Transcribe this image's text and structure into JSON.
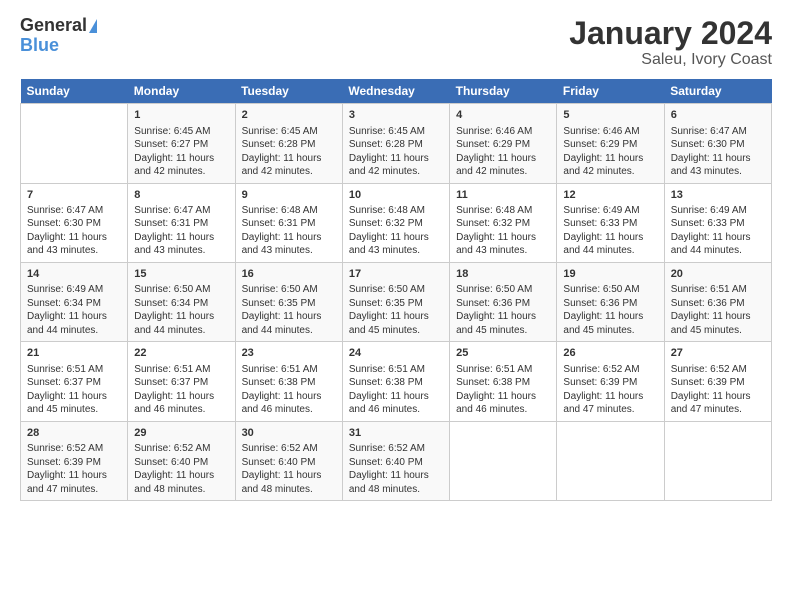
{
  "logo": {
    "line1": "General",
    "line2": "Blue"
  },
  "title": "January 2024",
  "subtitle": "Saleu, Ivory Coast",
  "days_header": [
    "Sunday",
    "Monday",
    "Tuesday",
    "Wednesday",
    "Thursday",
    "Friday",
    "Saturday"
  ],
  "weeks": [
    [
      {
        "day": "",
        "sunrise": "",
        "sunset": "",
        "daylight": ""
      },
      {
        "day": "1",
        "sunrise": "Sunrise: 6:45 AM",
        "sunset": "Sunset: 6:27 PM",
        "daylight": "Daylight: 11 hours and 42 minutes."
      },
      {
        "day": "2",
        "sunrise": "Sunrise: 6:45 AM",
        "sunset": "Sunset: 6:28 PM",
        "daylight": "Daylight: 11 hours and 42 minutes."
      },
      {
        "day": "3",
        "sunrise": "Sunrise: 6:45 AM",
        "sunset": "Sunset: 6:28 PM",
        "daylight": "Daylight: 11 hours and 42 minutes."
      },
      {
        "day": "4",
        "sunrise": "Sunrise: 6:46 AM",
        "sunset": "Sunset: 6:29 PM",
        "daylight": "Daylight: 11 hours and 42 minutes."
      },
      {
        "day": "5",
        "sunrise": "Sunrise: 6:46 AM",
        "sunset": "Sunset: 6:29 PM",
        "daylight": "Daylight: 11 hours and 42 minutes."
      },
      {
        "day": "6",
        "sunrise": "Sunrise: 6:47 AM",
        "sunset": "Sunset: 6:30 PM",
        "daylight": "Daylight: 11 hours and 43 minutes."
      }
    ],
    [
      {
        "day": "7",
        "sunrise": "Sunrise: 6:47 AM",
        "sunset": "Sunset: 6:30 PM",
        "daylight": "Daylight: 11 hours and 43 minutes."
      },
      {
        "day": "8",
        "sunrise": "Sunrise: 6:47 AM",
        "sunset": "Sunset: 6:31 PM",
        "daylight": "Daylight: 11 hours and 43 minutes."
      },
      {
        "day": "9",
        "sunrise": "Sunrise: 6:48 AM",
        "sunset": "Sunset: 6:31 PM",
        "daylight": "Daylight: 11 hours and 43 minutes."
      },
      {
        "day": "10",
        "sunrise": "Sunrise: 6:48 AM",
        "sunset": "Sunset: 6:32 PM",
        "daylight": "Daylight: 11 hours and 43 minutes."
      },
      {
        "day": "11",
        "sunrise": "Sunrise: 6:48 AM",
        "sunset": "Sunset: 6:32 PM",
        "daylight": "Daylight: 11 hours and 43 minutes."
      },
      {
        "day": "12",
        "sunrise": "Sunrise: 6:49 AM",
        "sunset": "Sunset: 6:33 PM",
        "daylight": "Daylight: 11 hours and 44 minutes."
      },
      {
        "day": "13",
        "sunrise": "Sunrise: 6:49 AM",
        "sunset": "Sunset: 6:33 PM",
        "daylight": "Daylight: 11 hours and 44 minutes."
      }
    ],
    [
      {
        "day": "14",
        "sunrise": "Sunrise: 6:49 AM",
        "sunset": "Sunset: 6:34 PM",
        "daylight": "Daylight: 11 hours and 44 minutes."
      },
      {
        "day": "15",
        "sunrise": "Sunrise: 6:50 AM",
        "sunset": "Sunset: 6:34 PM",
        "daylight": "Daylight: 11 hours and 44 minutes."
      },
      {
        "day": "16",
        "sunrise": "Sunrise: 6:50 AM",
        "sunset": "Sunset: 6:35 PM",
        "daylight": "Daylight: 11 hours and 44 minutes."
      },
      {
        "day": "17",
        "sunrise": "Sunrise: 6:50 AM",
        "sunset": "Sunset: 6:35 PM",
        "daylight": "Daylight: 11 hours and 45 minutes."
      },
      {
        "day": "18",
        "sunrise": "Sunrise: 6:50 AM",
        "sunset": "Sunset: 6:36 PM",
        "daylight": "Daylight: 11 hours and 45 minutes."
      },
      {
        "day": "19",
        "sunrise": "Sunrise: 6:50 AM",
        "sunset": "Sunset: 6:36 PM",
        "daylight": "Daylight: 11 hours and 45 minutes."
      },
      {
        "day": "20",
        "sunrise": "Sunrise: 6:51 AM",
        "sunset": "Sunset: 6:36 PM",
        "daylight": "Daylight: 11 hours and 45 minutes."
      }
    ],
    [
      {
        "day": "21",
        "sunrise": "Sunrise: 6:51 AM",
        "sunset": "Sunset: 6:37 PM",
        "daylight": "Daylight: 11 hours and 45 minutes."
      },
      {
        "day": "22",
        "sunrise": "Sunrise: 6:51 AM",
        "sunset": "Sunset: 6:37 PM",
        "daylight": "Daylight: 11 hours and 46 minutes."
      },
      {
        "day": "23",
        "sunrise": "Sunrise: 6:51 AM",
        "sunset": "Sunset: 6:38 PM",
        "daylight": "Daylight: 11 hours and 46 minutes."
      },
      {
        "day": "24",
        "sunrise": "Sunrise: 6:51 AM",
        "sunset": "Sunset: 6:38 PM",
        "daylight": "Daylight: 11 hours and 46 minutes."
      },
      {
        "day": "25",
        "sunrise": "Sunrise: 6:51 AM",
        "sunset": "Sunset: 6:38 PM",
        "daylight": "Daylight: 11 hours and 46 minutes."
      },
      {
        "day": "26",
        "sunrise": "Sunrise: 6:52 AM",
        "sunset": "Sunset: 6:39 PM",
        "daylight": "Daylight: 11 hours and 47 minutes."
      },
      {
        "day": "27",
        "sunrise": "Sunrise: 6:52 AM",
        "sunset": "Sunset: 6:39 PM",
        "daylight": "Daylight: 11 hours and 47 minutes."
      }
    ],
    [
      {
        "day": "28",
        "sunrise": "Sunrise: 6:52 AM",
        "sunset": "Sunset: 6:39 PM",
        "daylight": "Daylight: 11 hours and 47 minutes."
      },
      {
        "day": "29",
        "sunrise": "Sunrise: 6:52 AM",
        "sunset": "Sunset: 6:40 PM",
        "daylight": "Daylight: 11 hours and 48 minutes."
      },
      {
        "day": "30",
        "sunrise": "Sunrise: 6:52 AM",
        "sunset": "Sunset: 6:40 PM",
        "daylight": "Daylight: 11 hours and 48 minutes."
      },
      {
        "day": "31",
        "sunrise": "Sunrise: 6:52 AM",
        "sunset": "Sunset: 6:40 PM",
        "daylight": "Daylight: 11 hours and 48 minutes."
      },
      {
        "day": "",
        "sunrise": "",
        "sunset": "",
        "daylight": ""
      },
      {
        "day": "",
        "sunrise": "",
        "sunset": "",
        "daylight": ""
      },
      {
        "day": "",
        "sunrise": "",
        "sunset": "",
        "daylight": ""
      }
    ]
  ]
}
